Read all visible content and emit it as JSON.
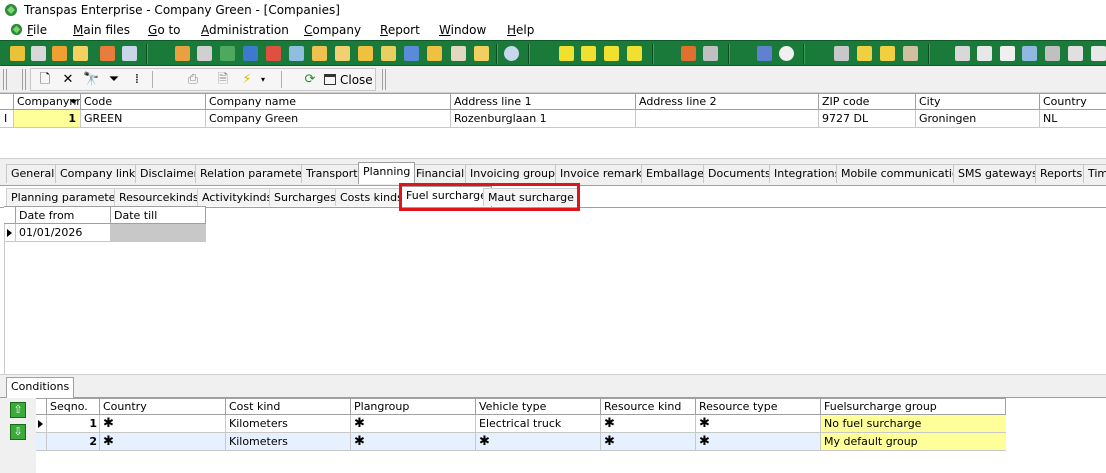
{
  "window": {
    "title": "Transpas Enterprise - Company Green - [Companies]"
  },
  "menu": [
    {
      "label": "File",
      "u": "F",
      "rest": "ile"
    },
    {
      "label": "Main files",
      "u": "M",
      "rest": "ain files"
    },
    {
      "label": "Go to",
      "u": "G",
      "rest": "o to"
    },
    {
      "label": "Administration",
      "u": "A",
      "rest": "dministration"
    },
    {
      "label": "Company",
      "u": "C",
      "rest": "ompany"
    },
    {
      "label": "Report",
      "u": "R",
      "rest": "eport"
    },
    {
      "label": "Window",
      "u": "W",
      "rest": "indow"
    },
    {
      "label": "Help",
      "u": "H",
      "rest": "elp"
    }
  ],
  "toolbar2": {
    "close_label": "Close"
  },
  "companies_grid": {
    "columns": [
      "Companynr",
      "Code",
      "Company name",
      "Address line 1",
      "Address line 2",
      "ZIP code",
      "City",
      "Country"
    ],
    "row_indicator": "I",
    "rows": [
      {
        "companynr": "1",
        "code": "GREEN",
        "name": "Company Green",
        "address1": "Rozenburglaan 1",
        "address2": "",
        "zip": "9727 DL",
        "city": "Groningen",
        "country": "NL"
      }
    ]
  },
  "main_tabs": [
    "General",
    "Company links",
    "Disclaimer",
    "Relation parameters",
    "Transport",
    "Planning",
    "Financial",
    "Invoicing groups",
    "Invoice remarks",
    "Emballage",
    "Documents",
    "Integrations",
    "Mobile communication",
    "SMS gateways",
    "Reports",
    "Tim"
  ],
  "main_tabs_active": "Planning",
  "sub_tabs": [
    "Planning parameters",
    "Resourcekinds",
    "Activitykinds",
    "Surcharges",
    "Costs kinds",
    "Fuel surcharge",
    "Maut surcharge"
  ],
  "sub_tabs_active": "Fuel surcharge",
  "date_grid": {
    "columns": [
      "Date from",
      "Date till"
    ],
    "rows": [
      {
        "date_from": "01/01/2026",
        "date_till": ""
      }
    ]
  },
  "conditions": {
    "tab_label": "Conditions",
    "columns": [
      "Seqno.",
      "Country",
      "Cost kind",
      "Plangroup",
      "Vehicle type",
      "Resource kind",
      "Resource type",
      "Fuelsurcharge group"
    ],
    "rows": [
      {
        "seqno": "1",
        "country": "*",
        "cost_kind": "Kilometers",
        "plangroup": "*",
        "vehicle_type": "Electrical truck",
        "resource_kind": "*",
        "resource_type": "*",
        "fuel_group": "No fuel surcharge"
      },
      {
        "seqno": "2",
        "country": "*",
        "cost_kind": "Kilometers",
        "plangroup": "*",
        "vehicle_type": "*",
        "resource_kind": "*",
        "resource_type": "*",
        "fuel_group": "My default group"
      }
    ]
  },
  "colors": {
    "green_toolbar": "#1a7a3a",
    "highlight_red": "#e0151a",
    "yellow_cell": "#ffff99",
    "selected_row": "#e6f0ff"
  }
}
